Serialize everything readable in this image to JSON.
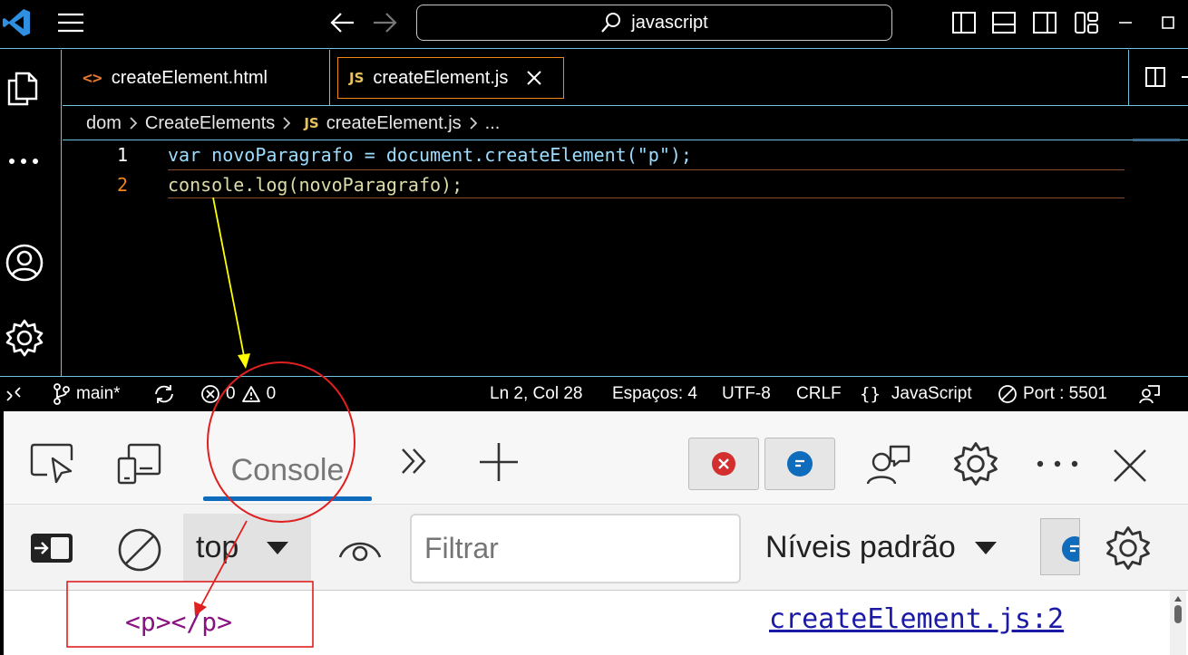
{
  "titlebar": {
    "search_text": "javascript"
  },
  "tabs": [
    {
      "label": "createElement.html",
      "icon": "html-icon",
      "active": false
    },
    {
      "label": "createElement.js",
      "icon": "js-icon",
      "badge": "JS",
      "active": true
    }
  ],
  "breadcrumb": {
    "items": [
      "dom",
      "CreateElements",
      "createElement.js",
      "..."
    ],
    "js_badge": "JS"
  },
  "editor": {
    "lines": [
      {
        "number": "1",
        "code": "var novoParagrafo = document.createElement(\"p\");"
      },
      {
        "number": "2",
        "code": "console.log(novoParagrafo);"
      }
    ]
  },
  "statusbar": {
    "branch": "main*",
    "errors": "0",
    "warnings": "0",
    "position": "Ln 2, Col 28",
    "spaces": "Espaços: 4",
    "encoding": "UTF-8",
    "eol": "CRLF",
    "language_braces": "{}",
    "language": "JavaScript",
    "port": "Port : 5501"
  },
  "devtools": {
    "console_tab": "Console",
    "context": "top",
    "filter_placeholder": "Filtrar",
    "levels": "Níveis padrão",
    "message": "<p></p>",
    "message_source": "createElement.js:2"
  },
  "colors": {
    "accent_border": "#6fc3df",
    "active_tab_border": "#f38518",
    "annotation_yellow": "#ffff00",
    "annotation_red": "#e02020",
    "devtools_underline": "#0f6cbd"
  }
}
